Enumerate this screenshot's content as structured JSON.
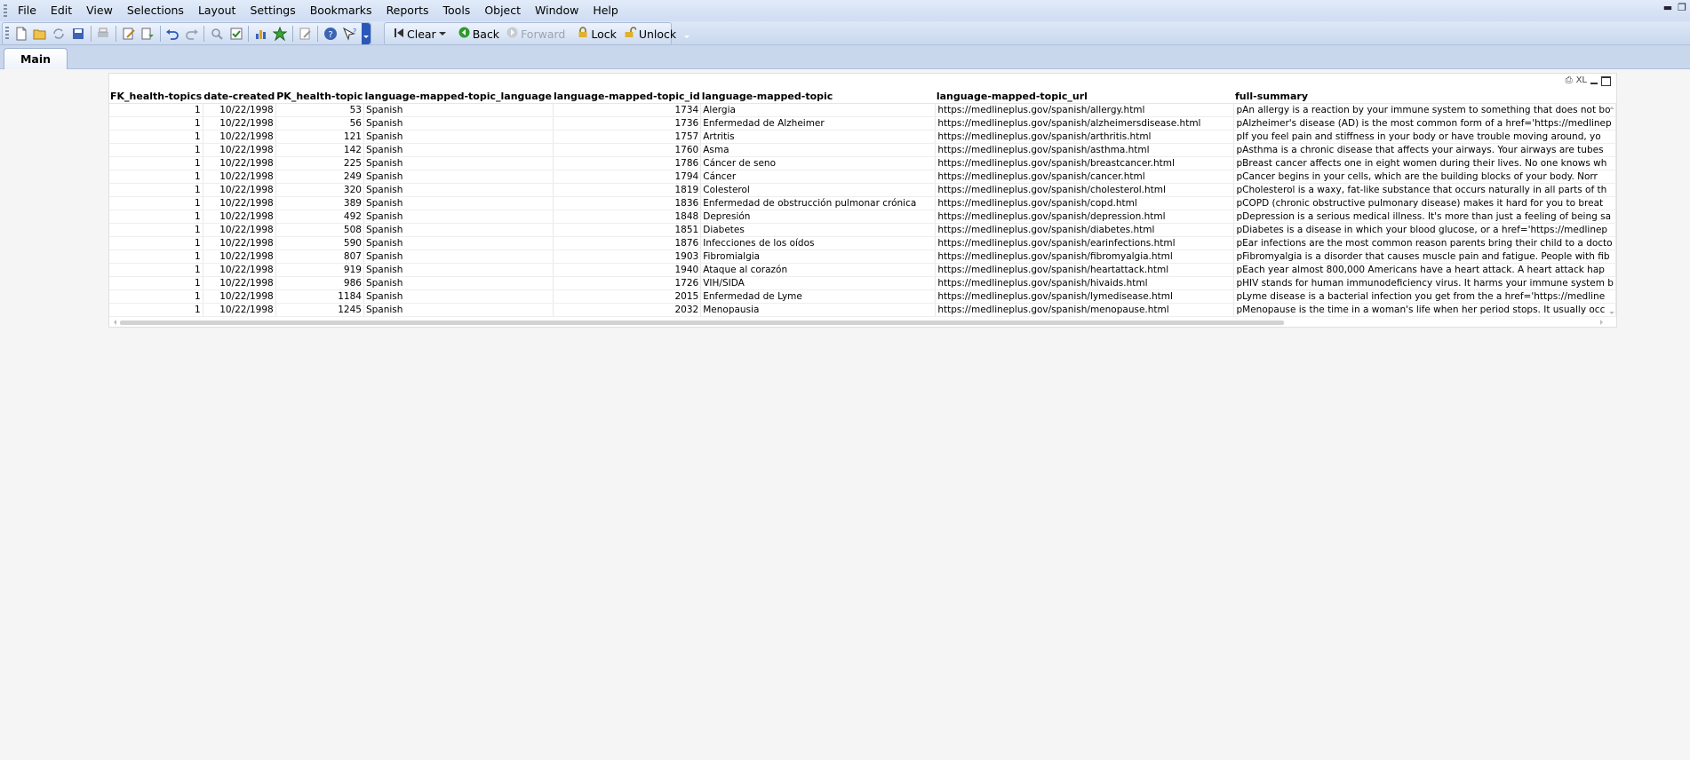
{
  "menu": [
    "File",
    "Edit",
    "View",
    "Selections",
    "Layout",
    "Settings",
    "Bookmarks",
    "Reports",
    "Tools",
    "Object",
    "Window",
    "Help"
  ],
  "toolbar": {
    "clear_label": "Clear",
    "back_label": "Back",
    "forward_label": "Forward",
    "lock_label": "Lock",
    "unlock_label": "Unlock"
  },
  "tabs": [
    "Main"
  ],
  "table": {
    "caption_icons": [
      "print-icon",
      "xl-export-icon",
      "minimize-icon",
      "maximize-icon"
    ],
    "xl_label": "XL",
    "columns": [
      "FK_health-topics",
      "date-created",
      "PK_health-topic",
      "language-mapped-topic_language",
      "language-mapped-topic_id",
      "language-mapped-topic",
      "language-mapped-topic_url",
      "full-summary"
    ],
    "rows": [
      [
        "1",
        "10/22/1998",
        "53",
        "Spanish",
        "1734",
        "Alergia",
        "https://medlineplus.gov/spanish/allergy.html",
        "pAn allergy is a reaction by your immune system to something that does not bo"
      ],
      [
        "1",
        "10/22/1998",
        "56",
        "Spanish",
        "1736",
        "Enfermedad de Alzheimer",
        "https://medlineplus.gov/spanish/alzheimersdisease.html",
        "pAlzheimer's disease (AD) is the most common form of a href='https://medlinep"
      ],
      [
        "1",
        "10/22/1998",
        "121",
        "Spanish",
        "1757",
        "Artritis",
        "https://medlineplus.gov/spanish/arthritis.html",
        "pIf you feel pain and stiffness in your body or have trouble moving around, yo"
      ],
      [
        "1",
        "10/22/1998",
        "142",
        "Spanish",
        "1760",
        "Asma",
        "https://medlineplus.gov/spanish/asthma.html",
        "pAsthma is a chronic disease that affects your airways. Your airways are tubes"
      ],
      [
        "1",
        "10/22/1998",
        "225",
        "Spanish",
        "1786",
        "Cáncer de seno",
        "https://medlineplus.gov/spanish/breastcancer.html",
        "pBreast cancer affects one in eight women during their lives. No one knows wh"
      ],
      [
        "1",
        "10/22/1998",
        "249",
        "Spanish",
        "1794",
        "Cáncer",
        "https://medlineplus.gov/spanish/cancer.html",
        "pCancer begins in your cells, which are the building blocks of your body.   Norr"
      ],
      [
        "1",
        "10/22/1998",
        "320",
        "Spanish",
        "1819",
        "Colesterol",
        "https://medlineplus.gov/spanish/cholesterol.html",
        "pCholesterol is a waxy, fat-like substance that occurs naturally in all parts of th"
      ],
      [
        "1",
        "10/22/1998",
        "389",
        "Spanish",
        "1836",
        "Enfermedad de obstrucción pulmonar crónica",
        "https://medlineplus.gov/spanish/copd.html",
        "pCOPD (chronic obstructive pulmonary disease) makes it hard for you to breat"
      ],
      [
        "1",
        "10/22/1998",
        "492",
        "Spanish",
        "1848",
        "Depresión",
        "https://medlineplus.gov/spanish/depression.html",
        "pDepression is a serious medical illness. It's more than just a feeling of being sa"
      ],
      [
        "1",
        "10/22/1998",
        "508",
        "Spanish",
        "1851",
        "Diabetes",
        "https://medlineplus.gov/spanish/diabetes.html",
        "pDiabetes is a disease in which your blood glucose, or a href='https://medlinep"
      ],
      [
        "1",
        "10/22/1998",
        "590",
        "Spanish",
        "1876",
        "Infecciones de los oídos",
        "https://medlineplus.gov/spanish/earinfections.html",
        "pEar infections are the most common reason parents bring their child to a docto"
      ],
      [
        "1",
        "10/22/1998",
        "807",
        "Spanish",
        "1903",
        "Fibromialgia",
        "https://medlineplus.gov/spanish/fibromyalgia.html",
        "pFibromyalgia is a disorder that causes muscle pain and fatigue. People with fib"
      ],
      [
        "1",
        "10/22/1998",
        "919",
        "Spanish",
        "1940",
        "Ataque al corazón",
        "https://medlineplus.gov/spanish/heartattack.html",
        "pEach year almost 800,000 Americans have a heart attack. A heart attack hap"
      ],
      [
        "1",
        "10/22/1998",
        "986",
        "Spanish",
        "1726",
        "VIH/SIDA",
        "https://medlineplus.gov/spanish/hivaids.html",
        "pHIV stands for human immunodeficiency virus. It harms your immune system b"
      ],
      [
        "1",
        "10/22/1998",
        "1184",
        "Spanish",
        "2015",
        "Enfermedad de Lyme",
        "https://medlineplus.gov/spanish/lymedisease.html",
        "pLyme disease is a bacterial infection you get from the a href='https://medline"
      ],
      [
        "1",
        "10/22/1998",
        "1245",
        "Spanish",
        "2032",
        "Menopausia",
        "https://medlineplus.gov/spanish/menopause.html",
        "pMenopause is the time in a woman's life when her period stops.  It usually occ"
      ]
    ]
  }
}
